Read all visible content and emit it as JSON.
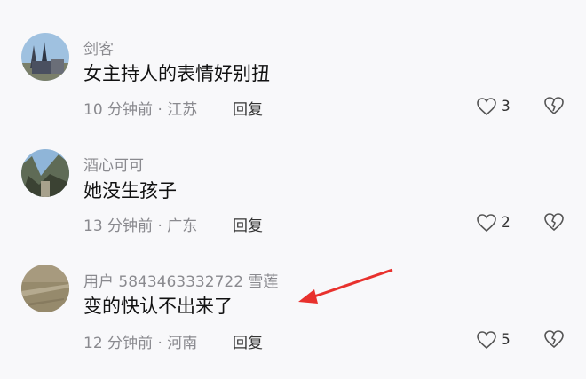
{
  "comments": [
    {
      "username": "剑客",
      "text": "女主持人的表情好别扭",
      "time": "10 分钟前",
      "location": "江苏",
      "reply_label": "回复",
      "likes": "3",
      "avatar_icon": "church-avatar-icon"
    },
    {
      "username": "酒心可可",
      "text": "她没生孩子",
      "time": "13 分钟前",
      "location": "广东",
      "reply_label": "回复",
      "likes": "2",
      "avatar_icon": "mountain-avatar-icon"
    },
    {
      "username": "用户 5843463332722 雪莲",
      "text": "变的快认不出来了",
      "time": "12 分钟前",
      "location": "河南",
      "reply_label": "回复",
      "likes": "5",
      "avatar_icon": "field-avatar-icon"
    }
  ],
  "meta_separator": "·",
  "colors": {
    "annotation_arrow": "#e8312d",
    "secondary_text": "#8a8a8f",
    "background": "#f8f8fa"
  }
}
